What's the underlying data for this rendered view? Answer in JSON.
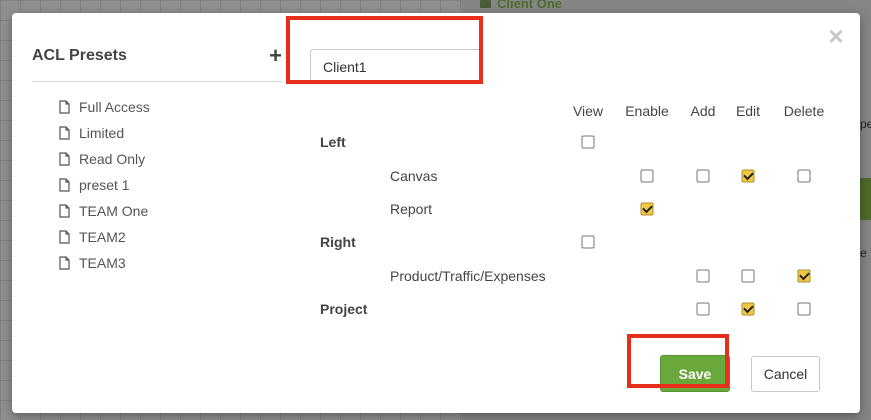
{
  "background": {
    "client_label": "Client One",
    "frag_top": "pe",
    "frag_bottom": "e"
  },
  "sidebar": {
    "title": "ACL Presets",
    "add_icon": "plus-icon",
    "items": [
      {
        "label": "Full Access"
      },
      {
        "label": "Limited"
      },
      {
        "label": "Read Only"
      },
      {
        "label": "preset 1"
      },
      {
        "label": "TEAM One"
      },
      {
        "label": "TEAM2"
      },
      {
        "label": "TEAM3"
      }
    ]
  },
  "form": {
    "name_value": "Client1"
  },
  "permissions": {
    "columns": [
      "View",
      "Enable",
      "Add",
      "Edit",
      "Delete"
    ],
    "rows": [
      {
        "label": "Left",
        "type": "section",
        "checks": {
          "View": false
        }
      },
      {
        "label": "Canvas",
        "type": "sub",
        "checks": {
          "Enable": false,
          "Add": false,
          "Edit": true,
          "Delete": false
        }
      },
      {
        "label": "Report",
        "type": "sub",
        "checks": {
          "Enable": true
        }
      },
      {
        "label": "Right",
        "type": "section",
        "checks": {
          "View": false
        }
      },
      {
        "label": "Product/Traffic/Expenses",
        "type": "sub",
        "checks": {
          "Add": false,
          "Edit": false,
          "Delete": true
        }
      },
      {
        "label": "Project",
        "type": "section",
        "checks": {
          "Add": false,
          "Edit": true,
          "Delete": false
        }
      }
    ]
  },
  "buttons": {
    "save": "Save",
    "cancel": "Cancel"
  },
  "close_icon": "close-icon",
  "colors": {
    "save_green": "#69a83a",
    "checkbox_checked": "#f2c744",
    "highlight_red": "#e62e1b"
  }
}
